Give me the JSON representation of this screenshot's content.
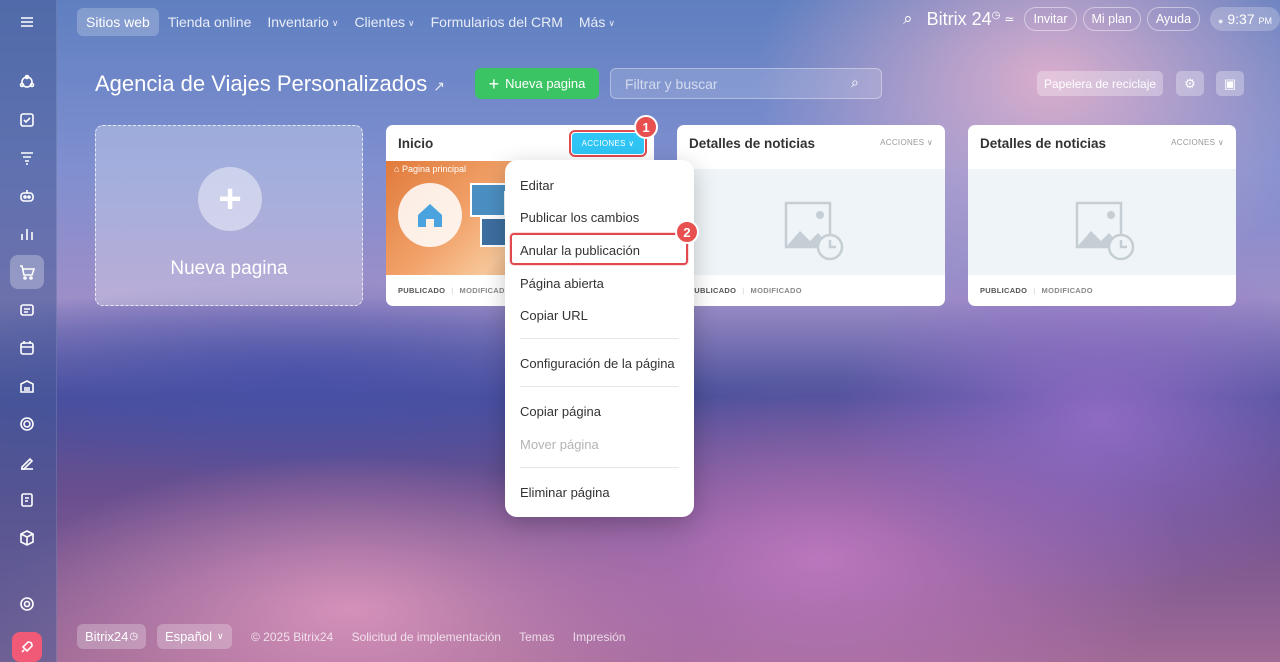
{
  "topnav": {
    "items": [
      "Sitios web",
      "Tienda online",
      "Inventario",
      "Clientes",
      "Formularios del CRM",
      "Más"
    ],
    "brand": "Bitrix 24",
    "invite": "Invitar",
    "plan": "Mi plan",
    "help": "Ayuda",
    "time": "9:37",
    "ampm": "PM"
  },
  "page": {
    "title": "Agencia de Viajes Personalizados",
    "new_button": "Nueva pagina",
    "search_placeholder": "Filtrar y buscar",
    "trash": "Papelera de reciclaje"
  },
  "new_card": {
    "label": "Nueva pagina"
  },
  "cards": [
    {
      "title": "Inicio",
      "actions": "ACCIONES",
      "preview_tab": "Pagina principal",
      "status": "PUBLICADO",
      "modified": "MODIFICADO"
    },
    {
      "title": "Detalles de noticias",
      "actions": "ACCIONES",
      "status": "PUBLICADO",
      "modified": "MODIFICADO"
    },
    {
      "title": "Detalles de noticias",
      "actions": "ACCIONES",
      "status": "PUBLICADO",
      "modified": "MODIFICADO"
    }
  ],
  "menu": {
    "items": [
      "Editar",
      "Publicar los cambios",
      "Anular la publicación",
      "Página abierta",
      "Copiar URL",
      "Configuración de la página",
      "Copiar página",
      "Mover página",
      "Eliminar página"
    ]
  },
  "badges": [
    "1",
    "2"
  ],
  "footer": {
    "brand": "Bitrix24",
    "language": "Español",
    "copyright": "© 2025 Bitrix24",
    "links": [
      "Solicitud de implementación",
      "Temas",
      "Impresión"
    ]
  },
  "colors": {
    "accent_green": "#3bc463",
    "actions_blue": "#2fc6f6",
    "highlight_red": "#e0494e",
    "launch_pink": "#f05a77"
  }
}
